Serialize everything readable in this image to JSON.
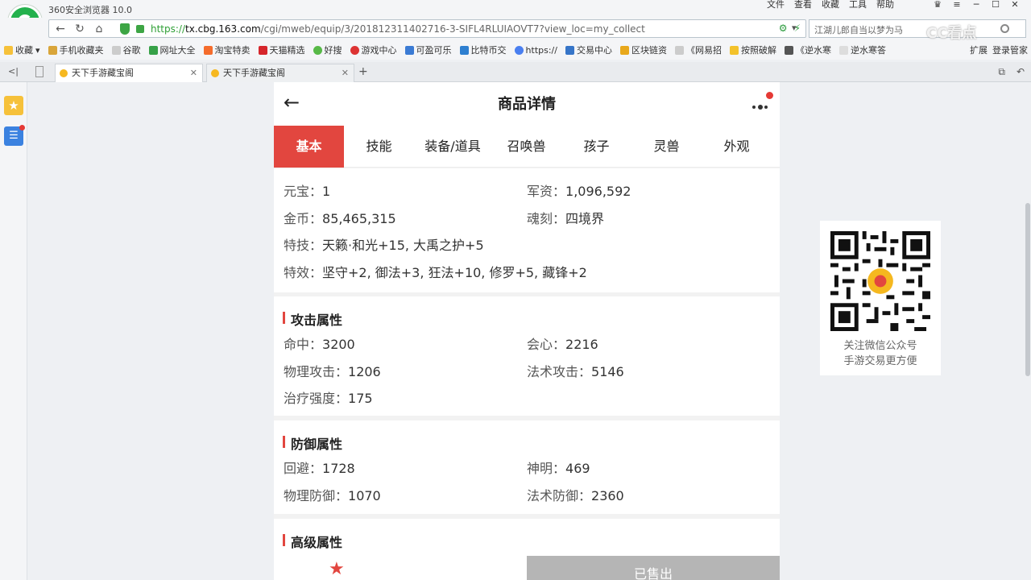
{
  "browser": {
    "app_title": "360安全浏览器 10.0",
    "menu": [
      "文件",
      "查看",
      "收藏",
      "工具",
      "帮助"
    ],
    "url_prefix": "https://",
    "url_host": "tx.cbg.163.com",
    "url_path": "/cgi/mweb/equip/3/201812311402716-3-SIFL4RLUIAOVT7?view_loc=my_collect",
    "search_text": "江湖儿郎自当以梦为马",
    "bookmarks": [
      "收藏",
      "手机收藏夹",
      "谷歌",
      "网址大全",
      "淘宝特卖",
      "天猫精选",
      "好搜",
      "游戏中心",
      "可盈可乐",
      "比特币交",
      "https://",
      "交易中心",
      "区块链资",
      "《网易招",
      "按照破解",
      "《逆水寒",
      "逆水寒答"
    ],
    "bookmarks_right": [
      "扩展",
      "登录管家"
    ],
    "tabs": [
      "天下手游藏宝阁",
      "天下手游藏宝阁"
    ],
    "watermark": "CC看点"
  },
  "page": {
    "title": "商品详情",
    "tabs": [
      "基本",
      "技能",
      "装备/道具",
      "召唤兽",
      "孩子",
      "灵兽",
      "外观"
    ],
    "basic": {
      "yuanbao_label": "元宝：",
      "yuanbao": "1",
      "junzi_label": "军资：",
      "junzi": "1,096,592",
      "jinbi_label": "金币：",
      "jinbi": "85,465,315",
      "hunke_label": "魂刻：",
      "hunke": "四境界",
      "teji_label": "特技：",
      "teji": "天籁·和光+15, 大禹之护+5",
      "texiao_label": "特效：",
      "texiao": "坚守+2, 御法+3, 狂法+10, 修罗+5, 藏锋+2"
    },
    "attack": {
      "title": "攻击属性",
      "mingzhong_label": "命中：",
      "mingzhong": "3200",
      "huixin_label": "会心：",
      "huixin": "2216",
      "wuligongji_label": "物理攻击：",
      "wuligongji": "1206",
      "fashugongji_label": "法术攻击：",
      "fashugongji": "5146",
      "zhiliao_label": "治疗强度：",
      "zhiliao": "175"
    },
    "defense": {
      "title": "防御属性",
      "huibi_label": "回避：",
      "huibi": "1728",
      "shenming_label": "神明：",
      "shenming": "469",
      "wulifangyu_label": "物理防御：",
      "wulifangyu": "1070",
      "fashufangyu_label": "法术防御：",
      "fashufangyu": "2360"
    },
    "advanced": {
      "title": "高级属性"
    },
    "sold_label": "已售出"
  },
  "qr": {
    "line1": "关注微信公众号",
    "line2": "手游交易更方便"
  },
  "colors": {
    "accent": "#e2463f",
    "browser_green": "#23b14d"
  }
}
